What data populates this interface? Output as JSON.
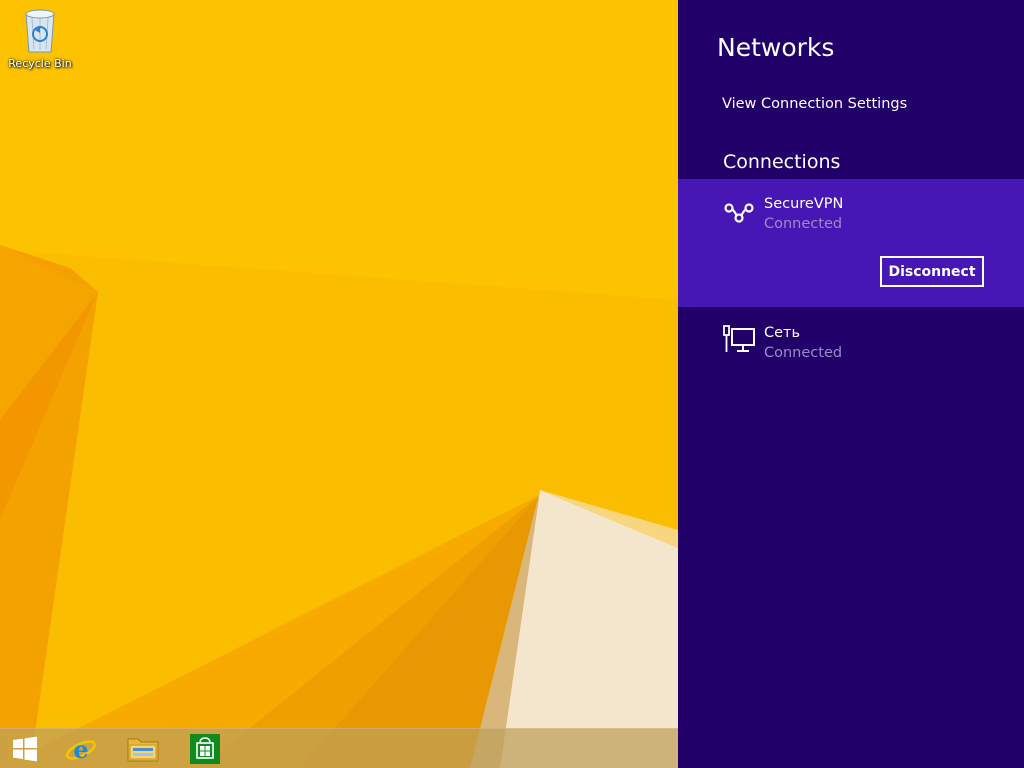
{
  "desktop": {
    "wallpaper_color": "#f9b400",
    "icons": [
      {
        "label": "Recycle Bin",
        "icon": "recycle-bin-icon"
      }
    ]
  },
  "taskbar": {
    "items": [
      {
        "name": "start-button",
        "icon": "windows-logo-icon"
      },
      {
        "name": "internet-explorer",
        "icon": "internet-explorer-icon"
      },
      {
        "name": "file-explorer",
        "icon": "folder-icon"
      },
      {
        "name": "store",
        "icon": "store-bag-icon"
      }
    ]
  },
  "networks_panel": {
    "title": "Networks",
    "view_settings_link": "View Connection Settings",
    "connections_heading": "Connections",
    "background_color": "#21006a",
    "selected_color": "#4617b4",
    "connections": [
      {
        "name": "SecureVPN",
        "status": "Connected",
        "icon": "vpn-icon",
        "selected": true,
        "action_label": "Disconnect"
      },
      {
        "name": "Сеть",
        "status": "Connected",
        "icon": "wired-network-icon",
        "selected": false
      }
    ]
  }
}
